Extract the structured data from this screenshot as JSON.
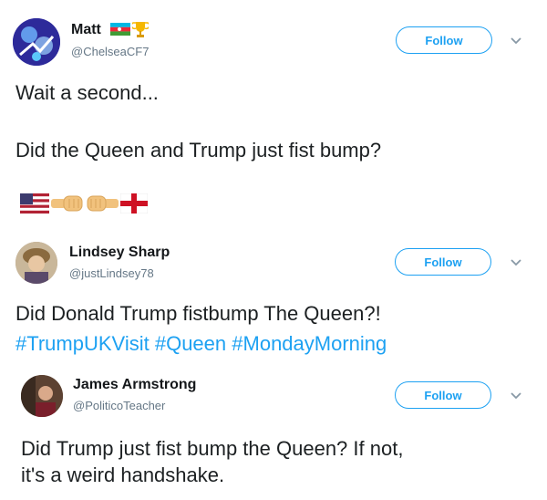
{
  "tweet1": {
    "name": "Matt",
    "handle": "@ChelseaCF7",
    "follow_label": "Follow",
    "line1": "Wait a second...",
    "line2": "Did the Queen and Trump just fist bump?",
    "emoji": [
      "us-flag-icon",
      "fist-right-icon",
      "fist-left-icon",
      "england-flag-icon"
    ]
  },
  "tweet2": {
    "name": "Lindsey Sharp",
    "handle": "@justLindsey78",
    "follow_label": "Follow",
    "line1": "Did Donald Trump fistbump The Queen?!",
    "hashtags": [
      "#TrumpUKVisit",
      "#Queen",
      "#MondayMorning"
    ]
  },
  "tweet3": {
    "name": "James Armstrong",
    "handle": "@PoliticoTeacher",
    "follow_label": "Follow",
    "line1": "Did Trump just fist bump the Queen? If not,",
    "line2": "it's a weird handshake."
  },
  "colors": {
    "accent": "#1da1f2",
    "text": "#1c2022",
    "secondary": "#657786"
  }
}
